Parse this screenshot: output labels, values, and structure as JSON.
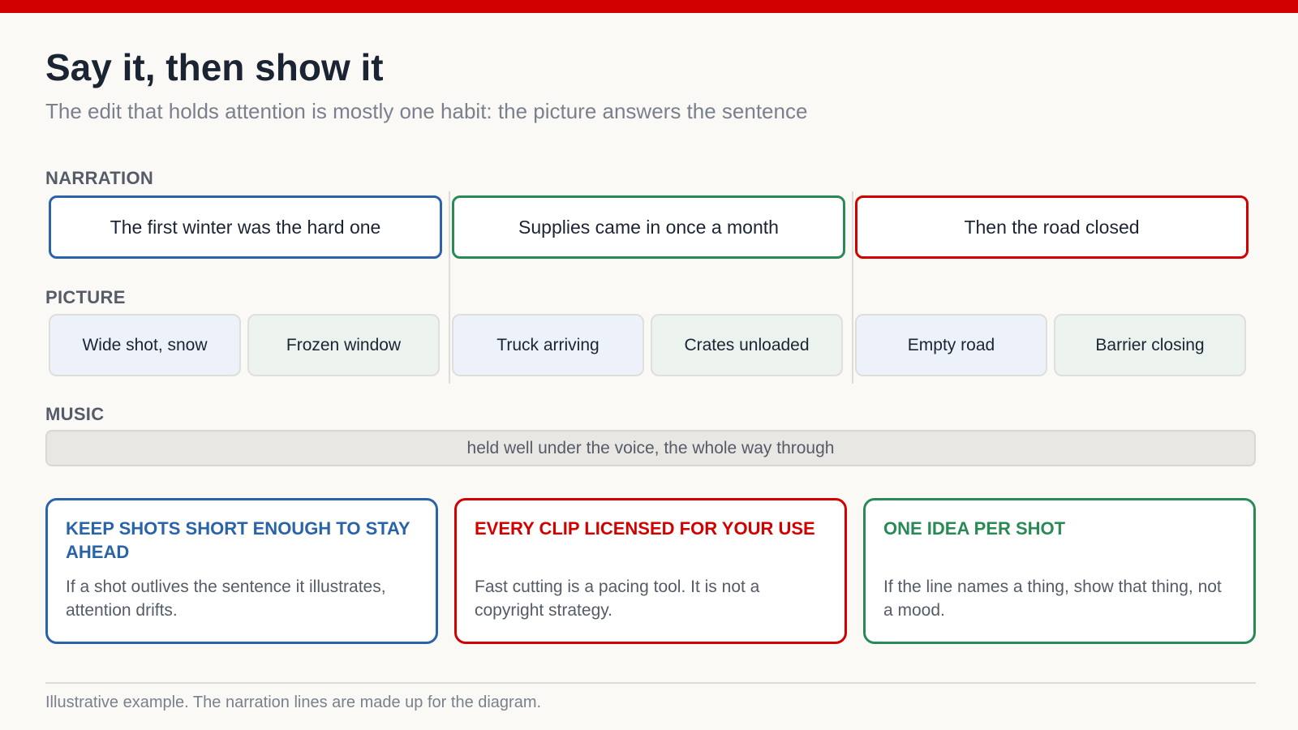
{
  "header": {
    "title": "Say it, then show it",
    "subtitle": "The edit that holds attention is mostly one habit: the picture answers the sentence"
  },
  "rows": {
    "narration_label": "NARRATION",
    "picture_label": "PICTURE",
    "music_label": "MUSIC"
  },
  "colors": {
    "accent_red": "#d30000",
    "blue": "#2a64a8",
    "green": "#2a8a55",
    "red": "#d30000"
  },
  "narration": [
    {
      "text": "The first winter was the hard one",
      "color": "#2a64a8"
    },
    {
      "text": "Supplies came in once a month",
      "color": "#2a8a55"
    },
    {
      "text": "Then the road closed",
      "color": "#d30000"
    }
  ],
  "pictures": [
    [
      "Wide shot, snow",
      "Frozen window"
    ],
    [
      "Truck arriving",
      "Crates unloaded"
    ],
    [
      "Empty road",
      "Barrier closing"
    ]
  ],
  "music": {
    "text": "held well under the voice, the whole way through"
  },
  "cards": [
    {
      "title": "KEEP SHOTS SHORT ENOUGH TO STAY AHEAD",
      "body": "If a shot outlives the sentence it illustrates, attention drifts.",
      "color": "#2a64a8"
    },
    {
      "title": "EVERY CLIP LICENSED FOR YOUR USE",
      "body": "Fast cutting is a pacing tool. It is not a copyright strategy.",
      "color": "#d30000"
    },
    {
      "title": "ONE IDEA PER SHOT",
      "body": "If the line names a thing, show that thing, not a mood.",
      "color": "#2a8a55"
    }
  ],
  "footer": {
    "note": "Illustrative example. The narration lines are made up for the diagram."
  }
}
